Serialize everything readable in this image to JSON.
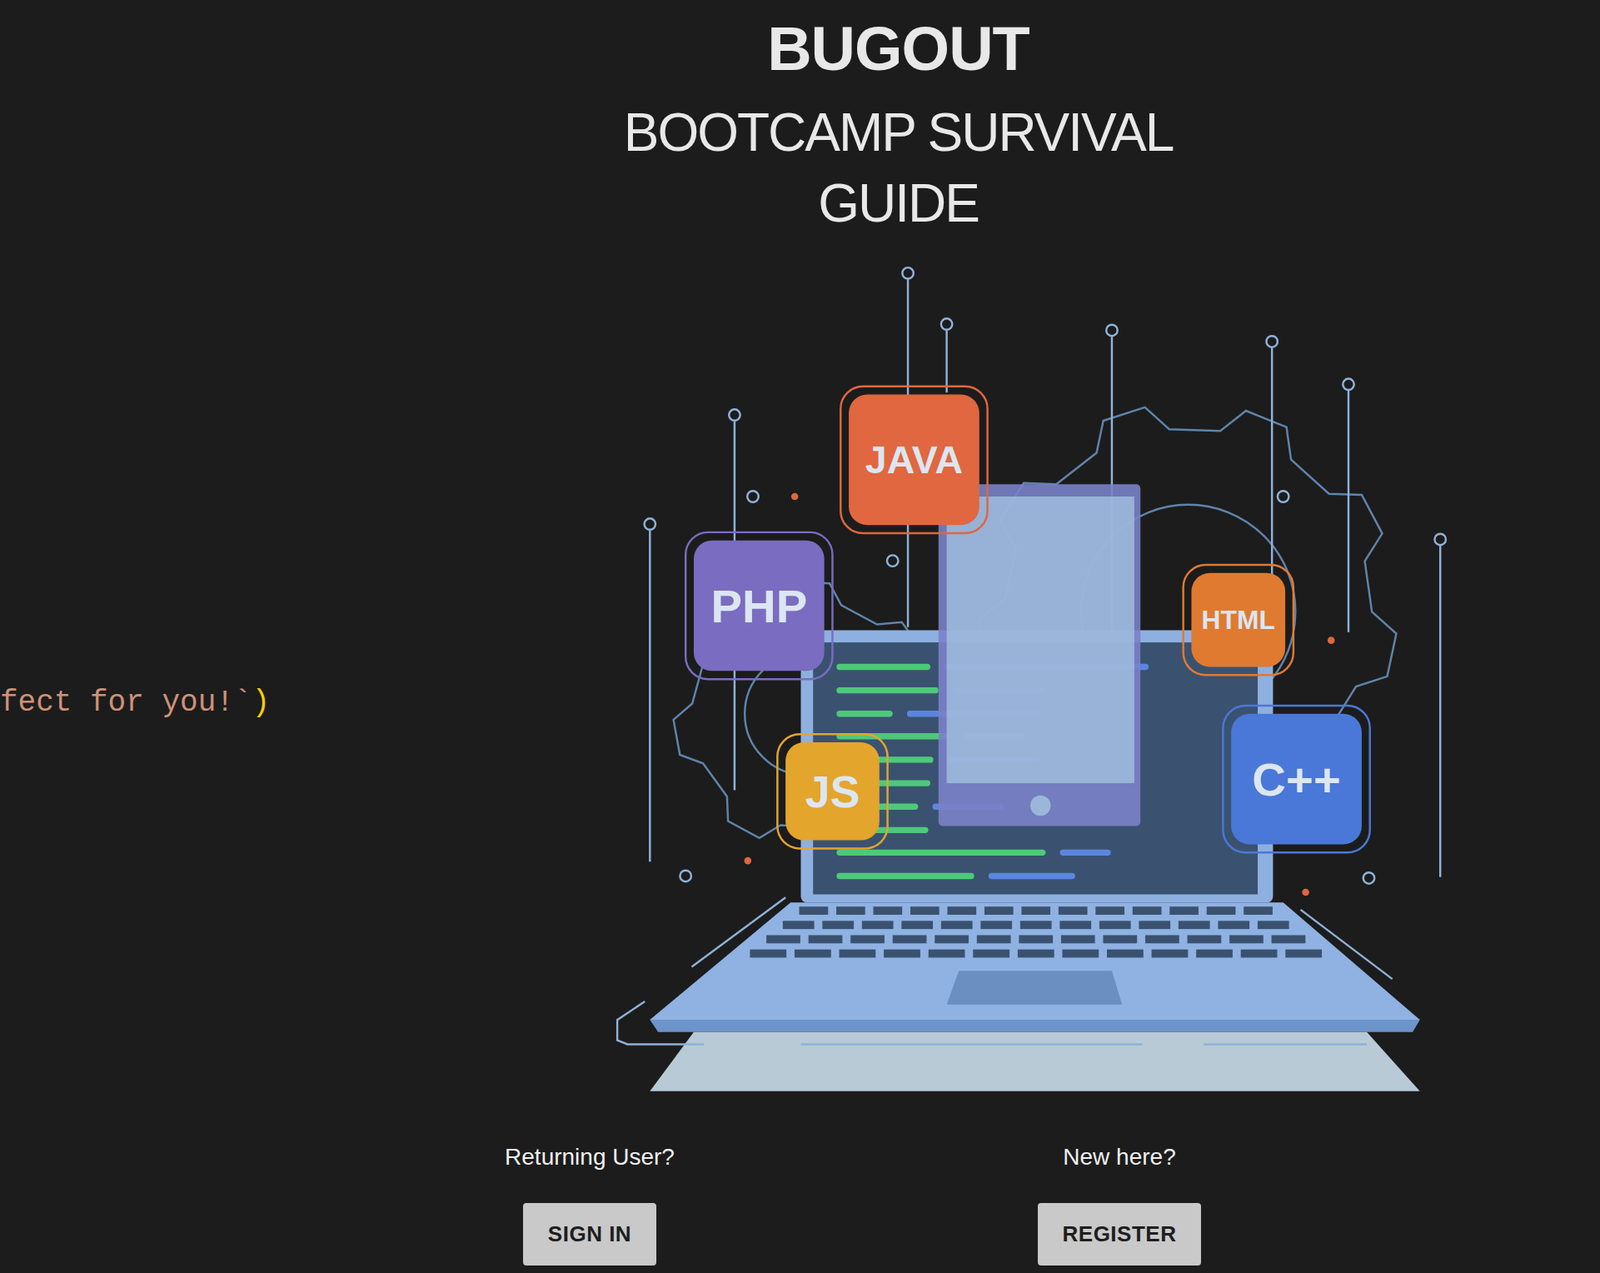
{
  "app": {
    "title": "BUGOUT",
    "subtitle": "BOOTCAMP SURVIVAL GUIDE"
  },
  "code_snippet": [
    {
      "text": "fect for you!`",
      "color": "#ce9178"
    },
    {
      "text": ")",
      "color": "#f5d000"
    }
  ],
  "illustration": {
    "badges": [
      {
        "label": "JAVA",
        "color": "#e0673f"
      },
      {
        "label": "PHP",
        "color": "#7a6cc0"
      },
      {
        "label": "JS",
        "color": "#e3a52c"
      },
      {
        "label": "HTML",
        "color": "#e07a30"
      },
      {
        "label": "C++",
        "color": "#4a78d8"
      }
    ]
  },
  "actions": [
    {
      "prompt": "Returning User?",
      "button": "SIGN IN"
    },
    {
      "prompt": "New here?",
      "button": "REGISTER"
    }
  ]
}
